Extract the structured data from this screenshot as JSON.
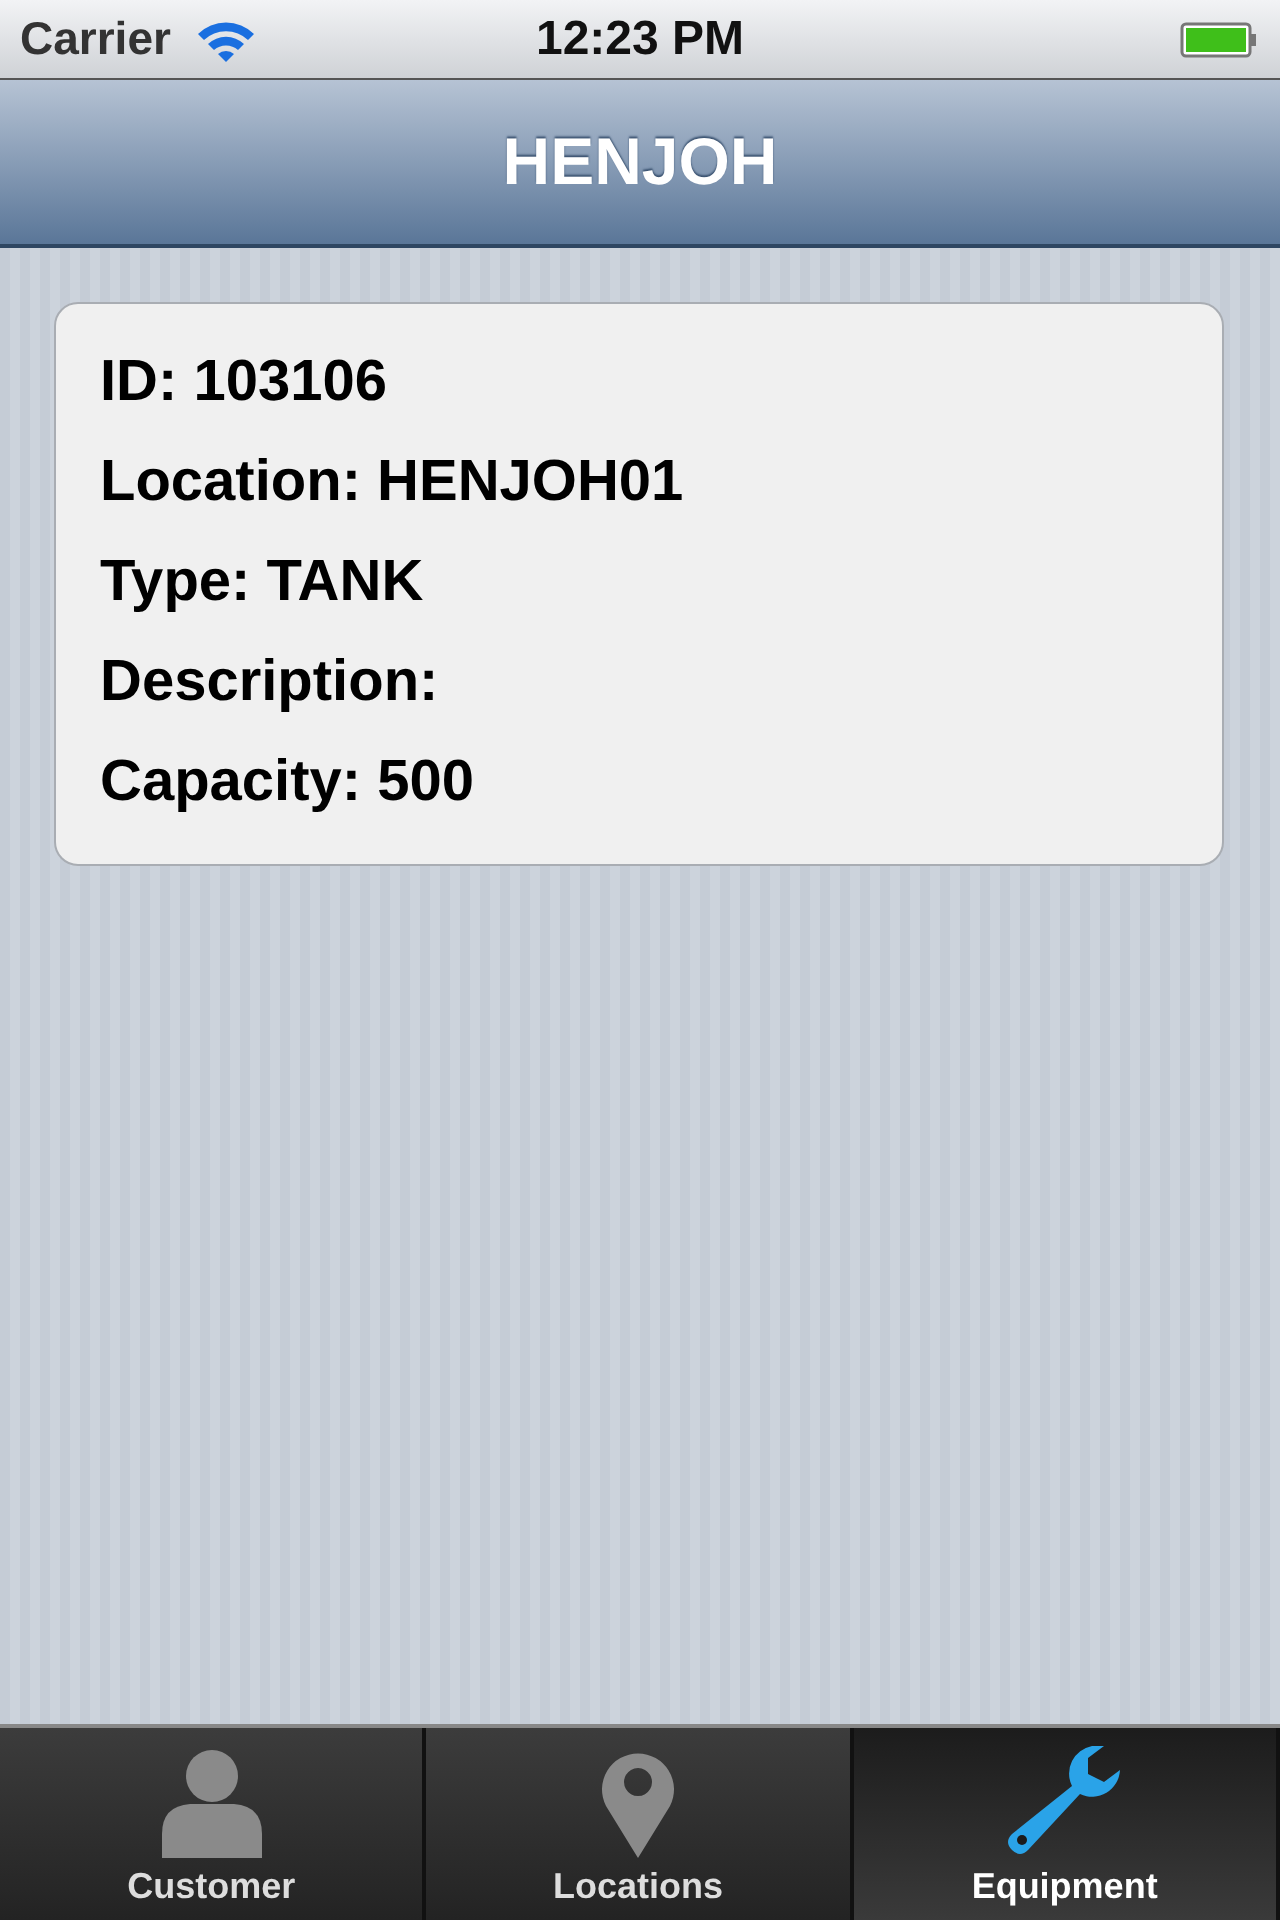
{
  "status_bar": {
    "carrier": "Carrier",
    "time": "12:23 PM"
  },
  "nav_bar": {
    "title": "HENJOH"
  },
  "details": [
    "ID: 103106",
    "Location: HENJOH01",
    "Type: TANK",
    "Description:",
    "Capacity: 500"
  ],
  "tab_bar": [
    {
      "label": "Customer",
      "kind": "person",
      "selected": false
    },
    {
      "label": "Locations",
      "kind": "pin",
      "selected": false
    },
    {
      "label": "Equipment",
      "kind": "wrench",
      "selected": true
    }
  ]
}
